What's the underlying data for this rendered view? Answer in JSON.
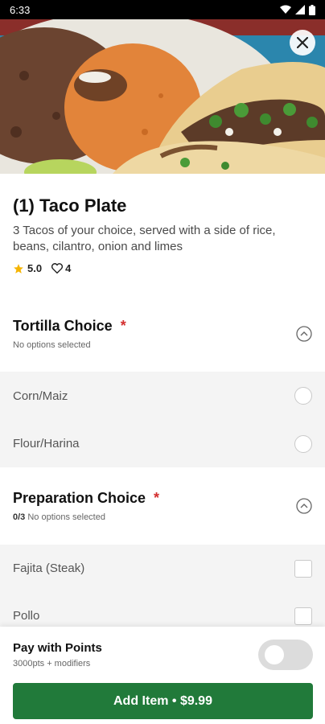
{
  "status_bar": {
    "time": "6:33"
  },
  "item": {
    "title": "(1) Taco Plate",
    "description": "3 Tacos of your choice, served with a side of rice, beans, cilantro, onion and limes",
    "rating": "5.0",
    "likes": "4"
  },
  "sections": [
    {
      "title": "Tortilla Choice",
      "required": "*",
      "count": "",
      "subtitle": "No options selected",
      "options": [
        "Corn/Maiz",
        "Flour/Harina"
      ]
    },
    {
      "title": "Preparation Choice",
      "required": "*",
      "count": "0/3",
      "subtitle": "No options selected",
      "options": [
        "Fajita (Steak)",
        "Pollo"
      ]
    }
  ],
  "points": {
    "label": "Pay with Points",
    "subtitle": "3000pts + modifiers",
    "enabled": false
  },
  "add_button": {
    "label": "Add Item • $9.99"
  },
  "colors": {
    "accent_green": "#217a3a",
    "required_red": "#d32f2f",
    "star_yellow": "#f5b400"
  }
}
